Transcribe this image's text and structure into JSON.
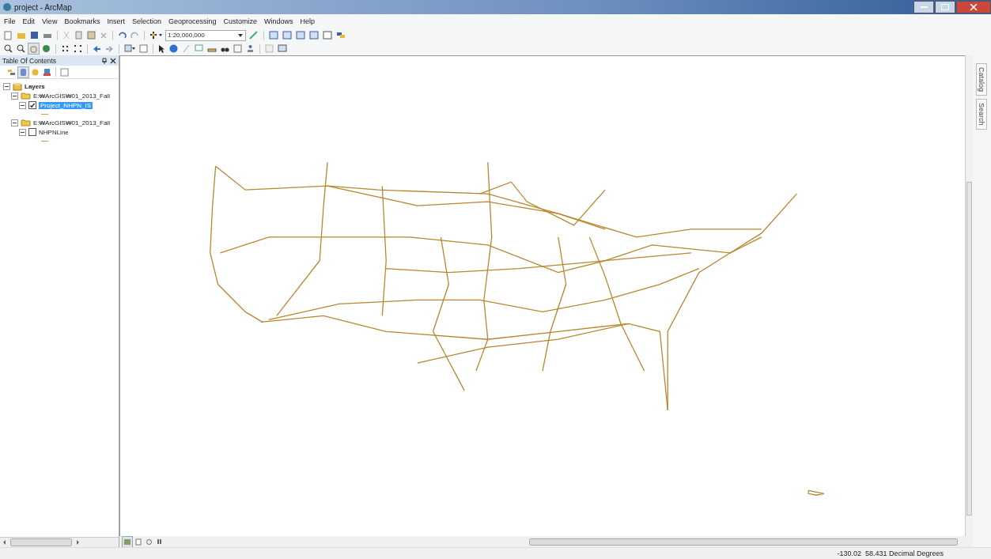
{
  "window": {
    "title": "project - ArcMap"
  },
  "menu": [
    "File",
    "Edit",
    "View",
    "Bookmarks",
    "Insert",
    "Selection",
    "Geoprocessing",
    "Customize",
    "Windows",
    "Help"
  ],
  "toolbar": {
    "scale": "1:20,000,000"
  },
  "toc": {
    "title": "Table Of Contents",
    "tree": [
      {
        "label": "Layers",
        "expanded": true,
        "children": [
          {
            "label": "E:₩ArcGIS₩01_2013_Fall",
            "expanded": true,
            "children": [
              {
                "label": "Project_NHPN_IS",
                "checked": true,
                "selected": true
              }
            ]
          },
          {
            "label": "E:₩ArcGIS₩01_2013_Fall",
            "expanded": true,
            "children": [
              {
                "label": "NHPNLine",
                "checked": false,
                "selected": false
              }
            ]
          }
        ]
      }
    ]
  },
  "side_tabs": [
    "Catalog",
    "Search"
  ],
  "status_bar": {
    "coordinates": "-130.02  58.431 Decimal Degrees"
  }
}
